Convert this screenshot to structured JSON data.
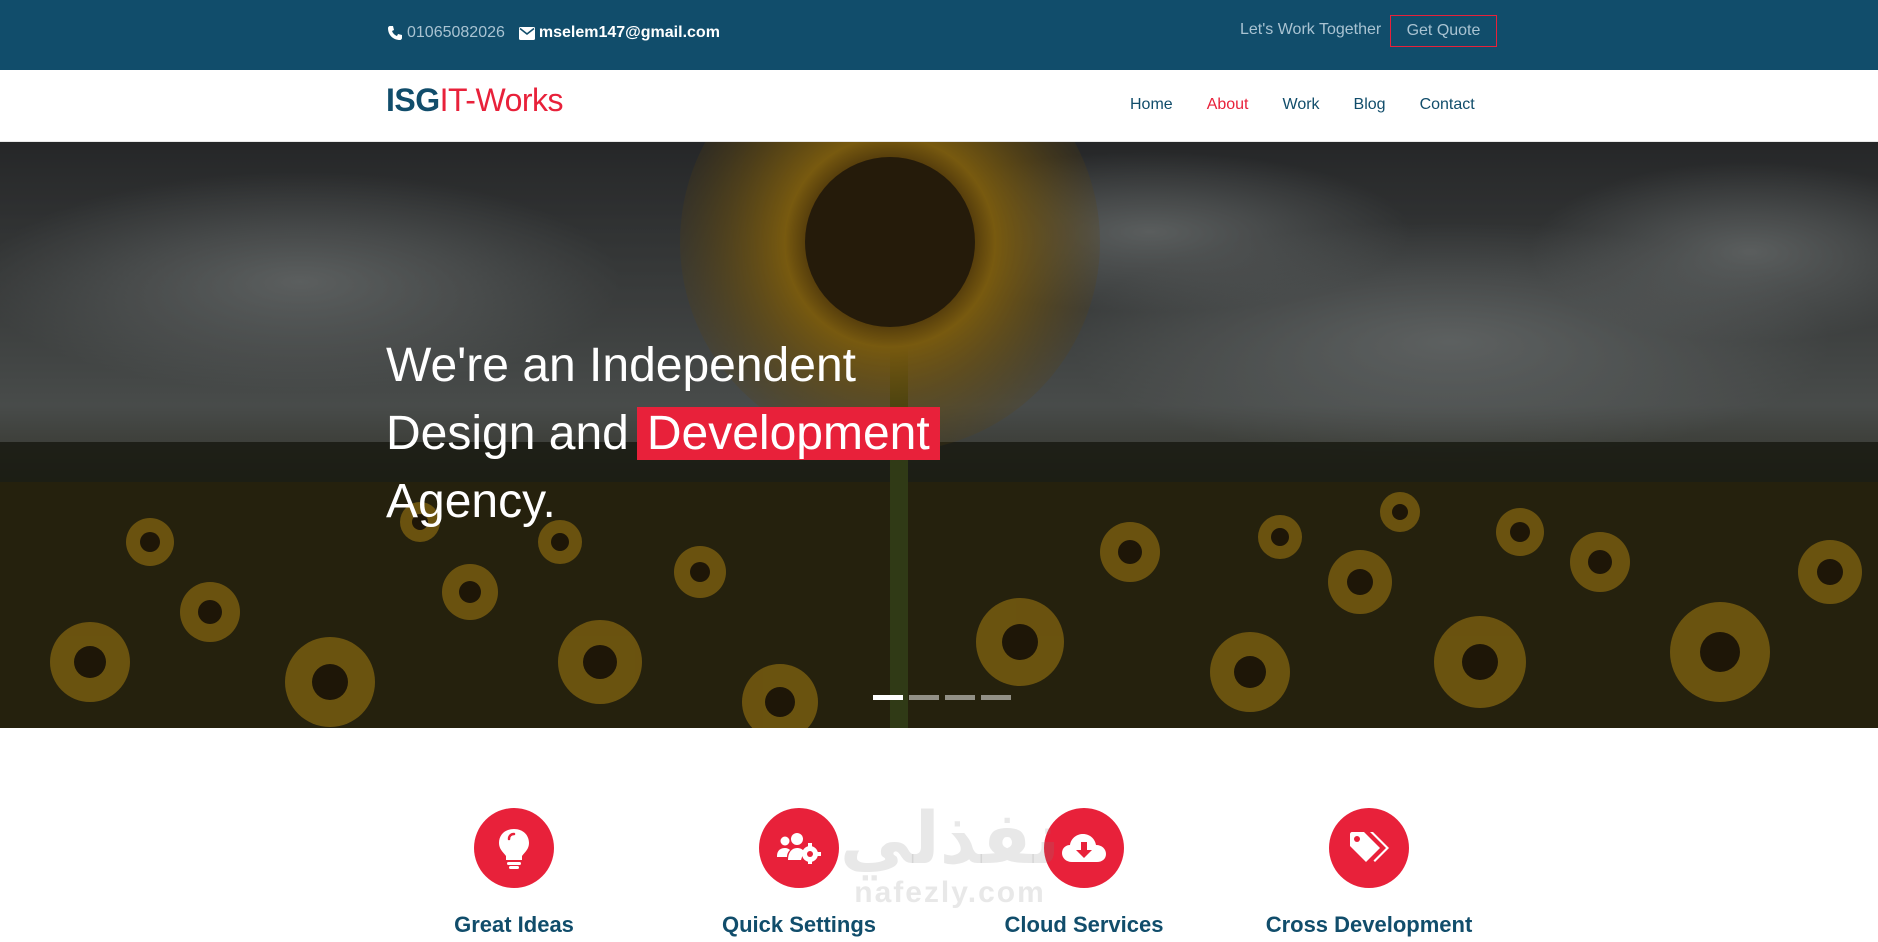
{
  "topbar": {
    "phone": "01065082026",
    "email": "mselem147@gmail.com",
    "tagline": "Let's Work Together",
    "quote_label": "Get Quote"
  },
  "brand": {
    "part1": "ISG",
    "part2": "IT-Works"
  },
  "nav": {
    "items": [
      {
        "label": "Home"
      },
      {
        "label": "About"
      },
      {
        "label": "Work"
      },
      {
        "label": "Blog"
      },
      {
        "label": "Contact"
      }
    ],
    "active": "About"
  },
  "hero": {
    "line1": "We're an Independent",
    "line2": "Design and",
    "highlight": "Development",
    "line3": "Agency.",
    "slides": 4,
    "current_slide": 1,
    "background": "sunflower field under cloudy sky"
  },
  "features": [
    {
      "title": "Great Ideas",
      "icon": "lightbulb-icon"
    },
    {
      "title": "Quick Settings",
      "icon": "users-gear-icon"
    },
    {
      "title": "Cloud Services",
      "icon": "cloud-download-icon"
    },
    {
      "title": "Cross Development",
      "icon": "tags-icon"
    }
  ],
  "watermark": {
    "arabic": "نفذلي",
    "latin": "nafezly.com"
  },
  "colors": {
    "primary": "#114d6b",
    "accent": "#e8213a",
    "white": "#ffffff"
  }
}
